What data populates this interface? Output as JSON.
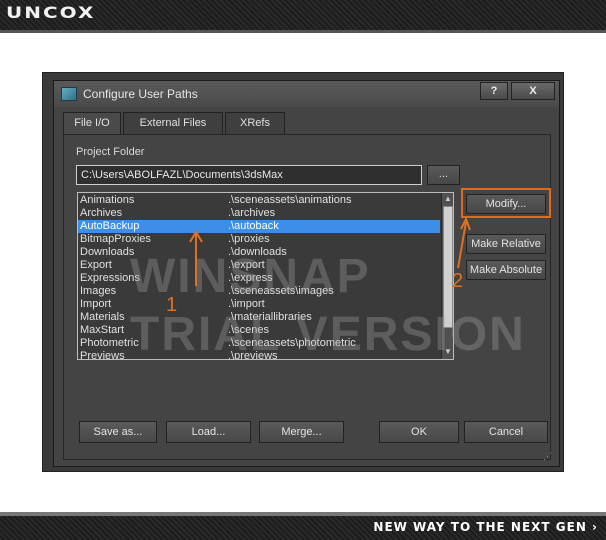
{
  "banner": {
    "logo": "UNCOX",
    "tagline": "NEW WAY TO THE NEXT GEN ›"
  },
  "dialog": {
    "title": "Configure User Paths",
    "help_label": "?",
    "close_label": "X",
    "tabs": [
      {
        "label": "File I/O",
        "active": true
      },
      {
        "label": "External Files",
        "active": false
      },
      {
        "label": "XRefs",
        "active": false
      }
    ],
    "project_folder_label": "Project Folder",
    "project_folder_path": "C:\\Users\\ABOLFAZL\\Documents\\3dsMax",
    "browse_label": "...",
    "paths": [
      {
        "name": "Animations",
        "path": ".\\sceneassets\\animations"
      },
      {
        "name": "Archives",
        "path": ".\\archives"
      },
      {
        "name": "AutoBackup",
        "path": ".\\autoback",
        "selected": true
      },
      {
        "name": "BitmapProxies",
        "path": ".\\proxies"
      },
      {
        "name": "Downloads",
        "path": ".\\downloads"
      },
      {
        "name": "Export",
        "path": ".\\export"
      },
      {
        "name": "Expressions",
        "path": ".\\express"
      },
      {
        "name": "Images",
        "path": ".\\sceneassets\\images"
      },
      {
        "name": "Import",
        "path": ".\\import"
      },
      {
        "name": "Materials",
        "path": ".\\materiallibraries"
      },
      {
        "name": "MaxStart",
        "path": ".\\scenes"
      },
      {
        "name": "Photometric",
        "path": ".\\sceneassets\\photometric"
      },
      {
        "name": "Previews",
        "path": ".\\previews"
      }
    ],
    "buttons": {
      "modify": "Modify...",
      "make_relative": "Make Relative",
      "make_absolute": "Make Absolute",
      "save_as": "Save as...",
      "load": "Load...",
      "merge": "Merge...",
      "ok": "OK",
      "cancel": "Cancel"
    }
  },
  "watermark": {
    "line1": "WINSNAP",
    "line2": "TRIAL VERSION"
  },
  "annotations": {
    "step1": "1",
    "step2": "2",
    "color": "#e07020"
  },
  "colors": {
    "dialog_bg": "#444444",
    "selection": "#3c8ee8",
    "highlight": "#e06a1a"
  }
}
